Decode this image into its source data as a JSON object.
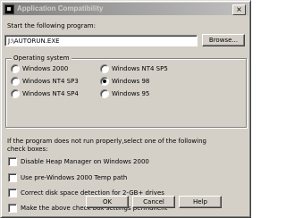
{
  "window": {
    "title": "Application Compatibility",
    "close_glyph": "×"
  },
  "program": {
    "prompt": "Start the following program:",
    "path": "J:\\AUTORUN.EXE",
    "browse_label": "Browse..."
  },
  "os_group": {
    "legend": "Operating system",
    "options": [
      {
        "label": "Windows 2000",
        "checked": false
      },
      {
        "label": "Windows NT4 SP5",
        "checked": false
      },
      {
        "label": "Windows NT4 SP3",
        "checked": false
      },
      {
        "label": "Windows 98",
        "checked": true
      },
      {
        "label": "Windows NT4 SP4",
        "checked": false
      },
      {
        "label": "Windows 95",
        "checked": false
      }
    ]
  },
  "instructions": {
    "line1": "If the program does not run properly,select one of the following",
    "line2": "check boxes:"
  },
  "checkboxes": [
    {
      "label": "Disable Heap Manager on Windows 2000",
      "checked": false
    },
    {
      "label": "Use pre-Windows 2000 Temp path",
      "checked": false
    },
    {
      "label": "Correct disk space detection for 2-GB+ drives",
      "checked": false
    },
    {
      "label": "Make the above check box settings permanent",
      "checked": false
    }
  ],
  "buttons": {
    "ok": "OK",
    "cancel": "Cancel",
    "help": "Help"
  }
}
